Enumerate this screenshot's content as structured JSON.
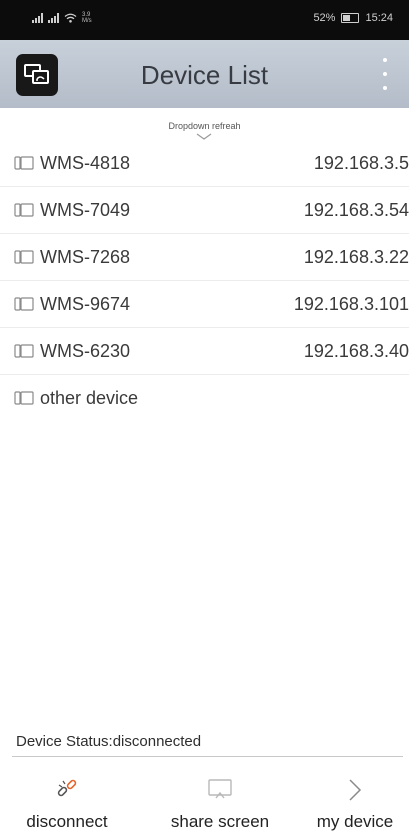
{
  "status_bar": {
    "speed": "3.9\nM/s",
    "battery": "52%",
    "time": "15:24"
  },
  "header": {
    "title": "Device List",
    "logo_icon": "screen-cast-logo-icon",
    "menu_icon": "more-vert-icon"
  },
  "refresh_hint": "Dropdown refreah",
  "devices": [
    {
      "name": "WMS-4818",
      "ip": "192.168.3.5"
    },
    {
      "name": "WMS-7049",
      "ip": "192.168.3.54"
    },
    {
      "name": "WMS-7268",
      "ip": "192.168.3.22"
    },
    {
      "name": "WMS-9674",
      "ip": "192.168.3.101"
    },
    {
      "name": "WMS-6230",
      "ip": "192.168.3.40"
    },
    {
      "name": "other device",
      "ip": ""
    }
  ],
  "device_status": "Device Status:disconnected",
  "bottom_nav": [
    {
      "label": "disconnect",
      "icon": "broken-link-icon"
    },
    {
      "label": "share screen",
      "icon": "cast-screen-icon"
    },
    {
      "label": "my device",
      "icon": "chevron-right-icon"
    }
  ],
  "colors": {
    "app_bar": "#b9c1cc",
    "status_bar": "#0c0c0c",
    "title_text": "#383c42",
    "link_icon": "#e8632b"
  }
}
